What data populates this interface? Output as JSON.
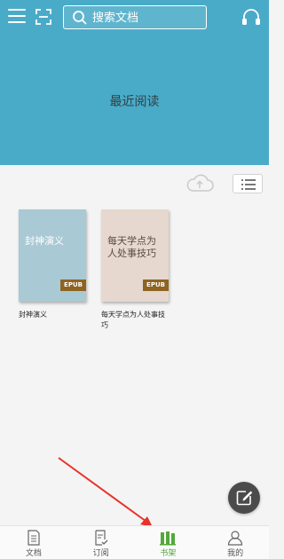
{
  "header": {
    "search_placeholder": "搜索文档",
    "banner_label": "最近阅读",
    "icons": [
      "menu-icon",
      "scan-icon",
      "search-icon",
      "headphone-icon"
    ]
  },
  "shelf": {
    "toolbar_icons": [
      "cloud-upload-icon",
      "list-view-icon"
    ],
    "books": [
      {
        "cover_text": "封神演义",
        "badge": "EPUB",
        "title": "封神演义",
        "cover_color": "#a9c9d4"
      },
      {
        "cover_text": "每天学点为人处事技巧",
        "badge": "EPUB",
        "title": "每天学点为人处事技巧",
        "cover_color": "#e6d8cf"
      }
    ]
  },
  "fab": {
    "icon": "compose-icon"
  },
  "tabs": [
    {
      "label": "文档",
      "icon": "document-icon",
      "active": false
    },
    {
      "label": "订阅",
      "icon": "subscribe-icon",
      "active": false
    },
    {
      "label": "书架",
      "icon": "bookshelf-icon",
      "active": true
    },
    {
      "label": "我的",
      "icon": "profile-icon",
      "active": false
    }
  ],
  "colors": {
    "header_bg": "#4aabc8",
    "active_tab": "#54a83b",
    "badge_bg": "#8e6422",
    "annotation_arrow": "#e8332a"
  }
}
